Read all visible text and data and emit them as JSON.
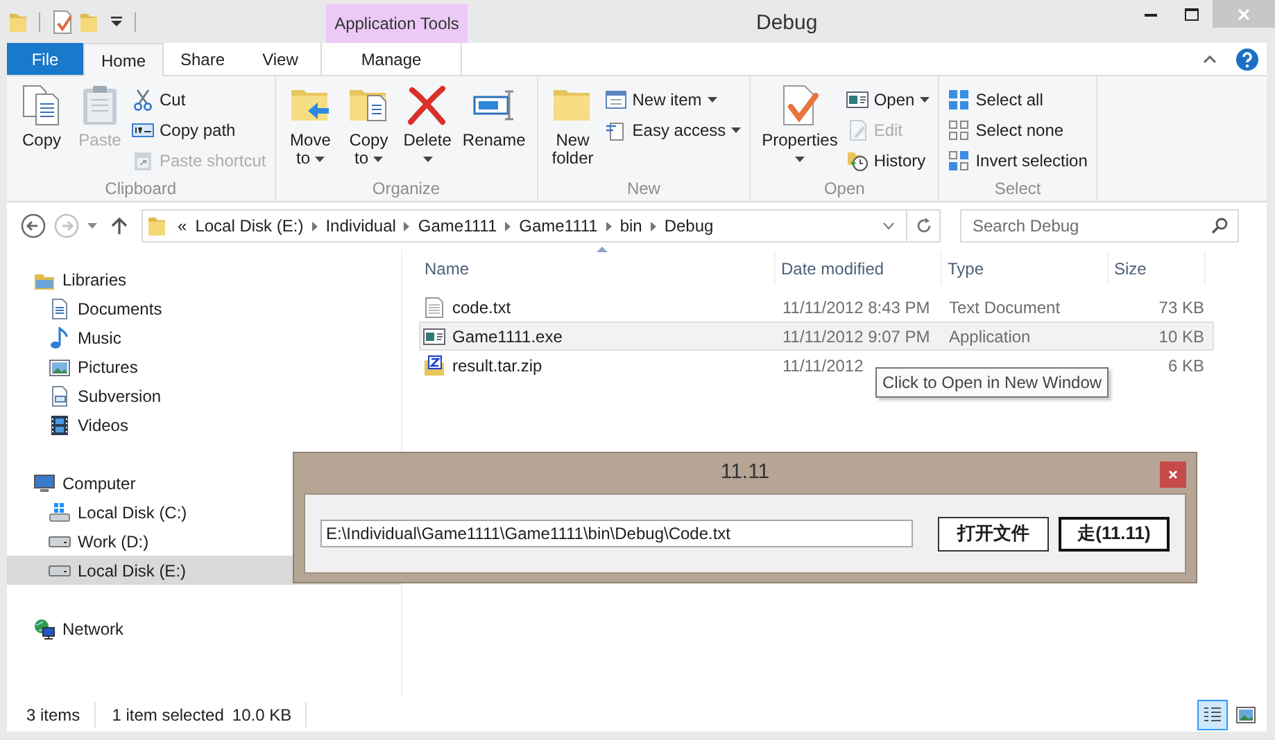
{
  "window": {
    "title": "Debug"
  },
  "contextual_tab": {
    "label": "Application Tools"
  },
  "ribbon_tabs": [
    {
      "label": "File",
      "kind": "file",
      "selected": false
    },
    {
      "label": "Home",
      "kind": "tab",
      "selected": true
    },
    {
      "label": "Share",
      "kind": "tab",
      "selected": false
    },
    {
      "label": "View",
      "kind": "tab",
      "selected": false
    },
    {
      "label": "Manage",
      "kind": "contextual",
      "selected": false
    }
  ],
  "ribbon_groups": [
    {
      "label": "Clipboard",
      "columns": [
        [
          {
            "kind": "large",
            "label": "Copy",
            "disabled": false,
            "dropdown": false
          }
        ],
        [
          {
            "kind": "large",
            "label": "Paste",
            "disabled": true,
            "dropdown": false
          }
        ],
        [
          {
            "kind": "small",
            "label": "Cut",
            "disabled": false,
            "dropdown": false
          },
          {
            "kind": "small",
            "label": "Copy path",
            "disabled": false,
            "dropdown": false
          },
          {
            "kind": "small",
            "label": "Paste shortcut",
            "disabled": true,
            "dropdown": false
          }
        ]
      ]
    },
    {
      "label": "Organize",
      "columns": [
        [
          {
            "kind": "large",
            "label": "Move to",
            "disabled": false,
            "dropdown": true
          }
        ],
        [
          {
            "kind": "large",
            "label": "Copy to",
            "disabled": false,
            "dropdown": true
          }
        ],
        [
          {
            "kind": "large",
            "label": "Delete",
            "disabled": false,
            "dropdown": true
          }
        ],
        [
          {
            "kind": "large",
            "label": "Rename",
            "disabled": false,
            "dropdown": false
          }
        ]
      ]
    },
    {
      "label": "New",
      "columns": [
        [
          {
            "kind": "large",
            "label": "New folder",
            "disabled": false,
            "dropdown": false
          }
        ],
        [
          {
            "kind": "small",
            "label": "New item",
            "disabled": false,
            "dropdown": true
          },
          {
            "kind": "small",
            "label": "Easy access",
            "disabled": false,
            "dropdown": true
          }
        ]
      ]
    },
    {
      "label": "Open",
      "columns": [
        [
          {
            "kind": "large",
            "label": "Properties",
            "disabled": false,
            "dropdown": true
          }
        ],
        [
          {
            "kind": "small",
            "label": "Open",
            "disabled": false,
            "dropdown": true
          },
          {
            "kind": "small",
            "label": "Edit",
            "disabled": true,
            "dropdown": false
          },
          {
            "kind": "small",
            "label": "History",
            "disabled": false,
            "dropdown": false
          }
        ]
      ]
    },
    {
      "label": "Select",
      "columns": [
        [
          {
            "kind": "small",
            "label": "Select all",
            "disabled": false,
            "dropdown": false
          },
          {
            "kind": "small",
            "label": "Select none",
            "disabled": false,
            "dropdown": false
          },
          {
            "kind": "small",
            "label": "Invert selection",
            "disabled": false,
            "dropdown": false
          }
        ]
      ]
    }
  ],
  "nav_buttons": [
    {
      "kind": "back",
      "disabled": false
    },
    {
      "kind": "forward",
      "disabled": true
    }
  ],
  "address": {
    "overflow_mark": "«",
    "segments": [
      "Local Disk (E:)",
      "Individual",
      "Game1111",
      "Game1111",
      "bin",
      "Debug"
    ]
  },
  "search": {
    "placeholder": "Search Debug"
  },
  "nav_tree": [
    {
      "label": "Libraries",
      "selected": false,
      "children": [
        {
          "label": "Documents",
          "selected": false
        },
        {
          "label": "Music",
          "selected": false
        },
        {
          "label": "Pictures",
          "selected": false
        },
        {
          "label": "Subversion",
          "selected": false
        },
        {
          "label": "Videos",
          "selected": false
        }
      ]
    },
    {
      "label": "Computer",
      "selected": false,
      "children": [
        {
          "label": "Local Disk (C:)",
          "selected": false
        },
        {
          "label": "Work (D:)",
          "selected": false
        },
        {
          "label": "Local Disk (E:)",
          "selected": true
        }
      ]
    },
    {
      "label": "Network",
      "selected": false
    }
  ],
  "file_list": {
    "columns": [
      {
        "label": "Name",
        "sorted": true
      },
      {
        "label": "Date modified",
        "sorted": false
      },
      {
        "label": "Type",
        "sorted": false
      },
      {
        "label": "Size",
        "sorted": false
      }
    ],
    "rows": [
      {
        "name": "code.txt",
        "kind": "text",
        "date": "11/11/2012 8:43 PM",
        "type": "Text Document",
        "size": "73 KB",
        "selected": false
      },
      {
        "name": "Game1111.exe",
        "kind": "exe",
        "date": "11/11/2012 9:07 PM",
        "type": "Application",
        "size": "10 KB",
        "selected": true
      },
      {
        "name": "result.tar.zip",
        "kind": "zip",
        "date": "11/11/2012",
        "size": "6 KB",
        "selected": false
      }
    ]
  },
  "tooltip": "Click to Open in New Window",
  "dialog": {
    "title": "11.11",
    "path_value": "E:\\Individual\\Game1111\\Game1111\\bin\\Debug\\Code.txt",
    "buttons": [
      {
        "label": "打开文件",
        "default": false
      },
      {
        "label": "走(11.11)",
        "default": true
      }
    ]
  },
  "status_bar": {
    "item_count": "3 items",
    "selection": "1 item selected",
    "selection_size": "10.0 KB",
    "views": [
      {
        "kind": "details",
        "selected": true
      },
      {
        "kind": "large_icons",
        "selected": false
      }
    ]
  }
}
